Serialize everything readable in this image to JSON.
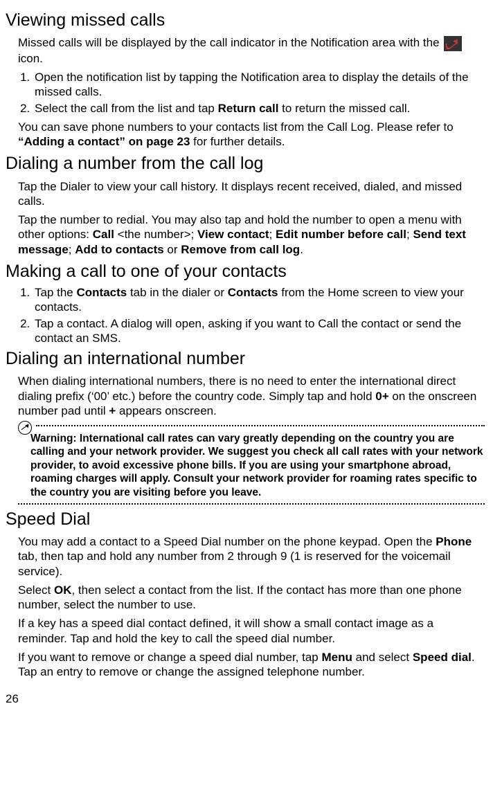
{
  "sections": {
    "missedCalls": {
      "heading": "Viewing missed calls",
      "introPart1": "Missed calls will be displayed by the call indicator in the Notification area with the ",
      "introPart2": " icon.",
      "step1": "Open the notification list by tapping the Notification area to display the details of the missed calls.",
      "step2a": "Select the call from the list and tap ",
      "step2b": "Return call",
      "step2c": " to return the missed call.",
      "footer1": "You can save phone numbers to your contacts list from the Call Log. Please refer to ",
      "footer2": "“Adding a contact” on page 23",
      "footer3": " for further details."
    },
    "callLog": {
      "heading": "Dialing a number from the call log",
      "p1": "Tap the Dialer to view your call history. It displays recent received, dialed, and missed calls.",
      "p2a": "Tap the number to redial. You may also tap and hold the number to open a menu with other options: ",
      "callLabel": "Call",
      "p2b": " <the number>; ",
      "viewContact": "View contact",
      "sep1": "; ",
      "editNumber": "Edit number before call",
      "sep2": "; ",
      "sendText": "Send text message",
      "sep3": "; ",
      "addContacts": "Add to contacts",
      "or": " or ",
      "remove": "Remove from call log",
      "period": "."
    },
    "contactsCall": {
      "heading": "Making a call to one of your contacts",
      "step1a": "Tap the ",
      "step1b": "Contacts",
      "step1c": " tab in the dialer or ",
      "step1d": "Contacts",
      "step1e": " from the Home screen to view your contacts.",
      "step2": "Tap a contact. A dialog will open, asking if you want to Call the contact or send the contact an SMS."
    },
    "intl": {
      "heading": "Dialing an international number",
      "p1a": "When dialing international numbers, there is no need to enter the international direct dialing prefix (‘00’ etc.) before the country code. Simply tap and hold ",
      "zeroPlus": "0+",
      "p1b": " on the onscreen number pad until ",
      "plus": "+",
      "p1c": " appears onscreen.",
      "warning": "Warning: International call rates can vary greatly depending on the country you are calling and your network provider. We suggest you check all call rates with your network provider, to avoid excessive phone bills. If you are using your smartphone abroad, roaming charges will apply. Consult your network provider for roaming rates specific to the country you are visiting before you leave."
    },
    "speedDial": {
      "heading": "Speed Dial",
      "p1a": "You may add a contact to a Speed Dial number on the phone keypad. Open the ",
      "phone": "Phone",
      "p1b": " tab, then tap and hold any number from 2 through 9 (1 is reserved for the voicemail service).",
      "p2a": "Select ",
      "ok": "OK",
      "p2b": ", then select a contact from the list. If the contact has more than one phone number, select the number to use.",
      "p3": "If a key has a speed dial contact defined, it will show a small contact image as a reminder. Tap and hold the key to call the speed dial number.",
      "p4a": "If you want to remove or change a speed dial number, tap ",
      "menu": "Menu",
      "p4b": " and select ",
      "speedDial": "Speed dial",
      "p4c": ". Tap an entry to remove or change the assigned telephone number."
    }
  },
  "pageNumber": "26"
}
